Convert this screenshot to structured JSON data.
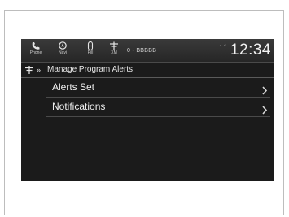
{
  "status_bar": {
    "phone_label": "Phone",
    "navi_label": "Navi",
    "pill_label": "Pill",
    "xm_label": "XM",
    "station_text": "0 - BBBBB",
    "signal_text": "´ ´",
    "clock": "12:34"
  },
  "breadcrumb": {
    "arrows": "»",
    "title": "Manage Program Alerts"
  },
  "menu": {
    "items": [
      {
        "label": "Alerts Set"
      },
      {
        "label": "Notifications"
      }
    ]
  },
  "icons": {
    "phone": "phone-icon",
    "navi": "navi-icon",
    "pill": "pill-icon",
    "xm": "xm-antenna-icon",
    "breadcrumb": "antenna-icon",
    "chevron": "chevron-right-icon"
  },
  "colors": {
    "screen_bg": "#1b1b1b",
    "statusbar_bg": "#2e2e2e",
    "text": "#efefef",
    "divider": "#4a4a4a"
  }
}
